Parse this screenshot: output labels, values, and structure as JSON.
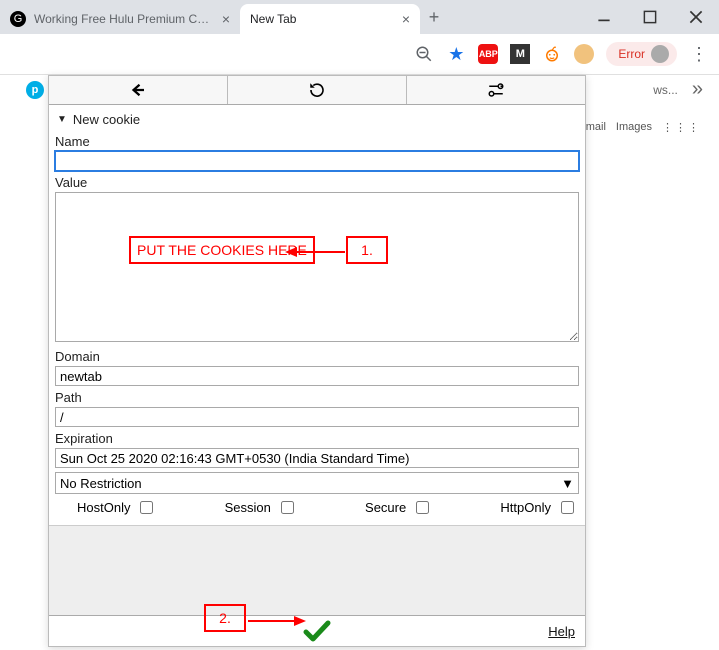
{
  "tabs": [
    {
      "title": "Working Free Hulu Premium Coo…",
      "faviconLetter": "G"
    },
    {
      "title": "New Tab"
    }
  ],
  "toolbar": {
    "errorLabel": "Error"
  },
  "background": {
    "gmail": "Gmail",
    "images": "Images",
    "ws": "ws..."
  },
  "panel": {
    "header": "New cookie",
    "labels": {
      "name": "Name",
      "value": "Value",
      "domain": "Domain",
      "path": "Path",
      "expiration": "Expiration"
    },
    "fields": {
      "name": "",
      "value": "",
      "domain": "newtab",
      "path": "/",
      "expiration": "Sun Oct 25 2020 02:16:43 GMT+0530 (India Standard Time)"
    },
    "restriction": "No Restriction",
    "checks": {
      "hostOnly": "HostOnly",
      "session": "Session",
      "secure": "Secure",
      "httpOnly": "HttpOnly"
    },
    "help": "Help"
  },
  "annotations": {
    "putCookies": "PUT THE COOKIES HERE",
    "step1": "1.",
    "step2": "2."
  }
}
